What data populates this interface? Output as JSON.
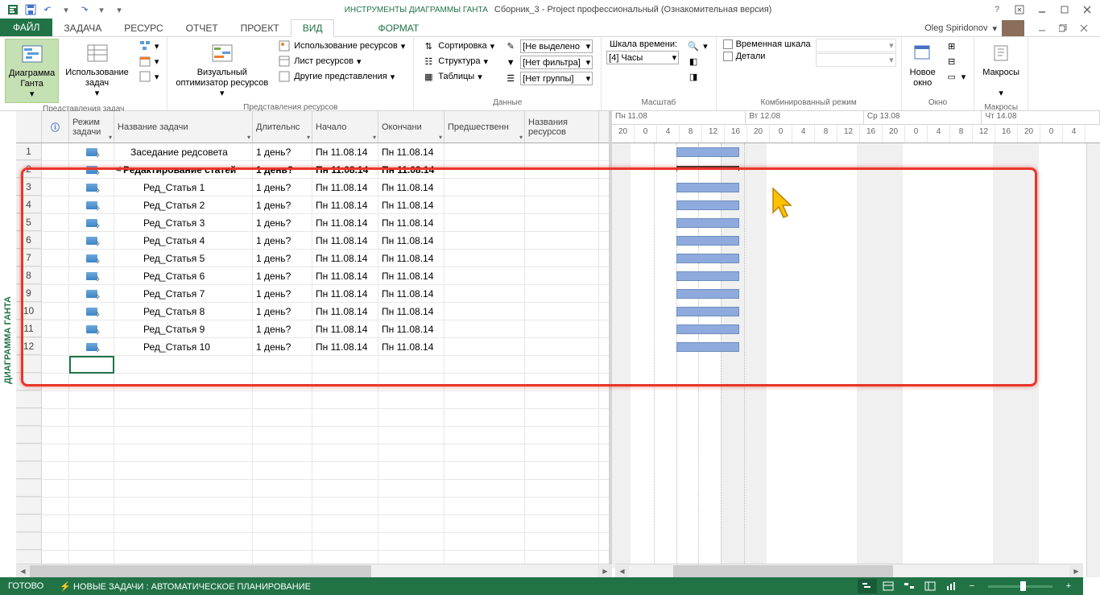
{
  "titlebar": {
    "tools_label": "ИНСТРУМЕНТЫ ДИАГРАММЫ ГАНТА",
    "window_title": "Сборник_3 - Project профессиональный (Ознакомительная версия)",
    "help": "?"
  },
  "tabs": {
    "file": "ФАЙЛ",
    "task": "ЗАДАЧА",
    "resource": "РЕСУРС",
    "report": "ОТЧЕТ",
    "project": "ПРОЕКТ",
    "view": "ВИД",
    "format": "ФОРМАТ"
  },
  "user": {
    "name": "Oleg Spiridonov"
  },
  "ribbon": {
    "group1": {
      "gantt": "Диаграмма\nГанта",
      "usage": "Использование\nзадач",
      "label": "Представления задач"
    },
    "group2": {
      "optimizer": "Визуальный\nоптимизатор ресурсов",
      "res_usage": "Использование ресурсов",
      "res_sheet": "Лист ресурсов",
      "other": "Другие представления",
      "label": "Представления ресурсов"
    },
    "group3": {
      "sort": "Сортировка",
      "structure": "Структура",
      "tables": "Таблицы",
      "highlight": "[Не выделено",
      "filter": "[Нет фильтра]",
      "group": "[Нет группы]",
      "label": "Данные"
    },
    "group4": {
      "timescale_label": "Шкала времени:",
      "timescale_value": "[4] Часы",
      "label": "Масштаб"
    },
    "group5": {
      "timeline": "Временная шкала",
      "details": "Детали",
      "label": "Комбинированный режим"
    },
    "group6": {
      "newwin": "Новое\nокно",
      "label": "Окно"
    },
    "group7": {
      "macros": "Макросы",
      "label": "Макросы"
    }
  },
  "side_label": "ДИАГРАММА ГАНТА",
  "columns": {
    "info": "",
    "mode": "Режим\nзадачи",
    "name": "Название задачи",
    "duration": "Длительнс",
    "start": "Начало",
    "finish": "Окончани",
    "pred": "Предшественн",
    "res": "Названия\nресурсов"
  },
  "timeline": {
    "days": [
      "Пн 11.08",
      "Вт 12.08",
      "Ср 13.08",
      "Чт 14.08"
    ],
    "hours": [
      "20",
      "0",
      "4",
      "8",
      "12",
      "16",
      "20",
      "0",
      "4",
      "8",
      "12",
      "16",
      "20",
      "0",
      "4",
      "8",
      "12",
      "16",
      "20",
      "0",
      "4"
    ]
  },
  "tasks": [
    {
      "num": "1",
      "name": "Заседание редсовета",
      "dur": "1 день?",
      "start": "Пн 11.08.14",
      "finish": "Пн 11.08.14",
      "bold": false,
      "indent": 1
    },
    {
      "num": "2",
      "name": "Редактирование статей",
      "dur": "1 день?",
      "start": "Пн 11.08.14",
      "finish": "Пн 11.08.14",
      "bold": true,
      "indent": 0,
      "summary": true
    },
    {
      "num": "3",
      "name": "Ред_Статья 1",
      "dur": "1 день?",
      "start": "Пн 11.08.14",
      "finish": "Пн 11.08.14",
      "bold": false,
      "indent": 2
    },
    {
      "num": "4",
      "name": "Ред_Статья 2",
      "dur": "1 день?",
      "start": "Пн 11.08.14",
      "finish": "Пн 11.08.14",
      "bold": false,
      "indent": 2
    },
    {
      "num": "5",
      "name": "Ред_Статья 3",
      "dur": "1 день?",
      "start": "Пн 11.08.14",
      "finish": "Пн 11.08.14",
      "bold": false,
      "indent": 2
    },
    {
      "num": "6",
      "name": "Ред_Статья 4",
      "dur": "1 день?",
      "start": "Пн 11.08.14",
      "finish": "Пн 11.08.14",
      "bold": false,
      "indent": 2
    },
    {
      "num": "7",
      "name": "Ред_Статья 5",
      "dur": "1 день?",
      "start": "Пн 11.08.14",
      "finish": "Пн 11.08.14",
      "bold": false,
      "indent": 2
    },
    {
      "num": "8",
      "name": "Ред_Статья 6",
      "dur": "1 день?",
      "start": "Пн 11.08.14",
      "finish": "Пн 11.08.14",
      "bold": false,
      "indent": 2
    },
    {
      "num": "9",
      "name": "Ред_Статья 7",
      "dur": "1 день?",
      "start": "Пн 11.08.14",
      "finish": "Пн 11.08.14",
      "bold": false,
      "indent": 2
    },
    {
      "num": "10",
      "name": "Ред_Статья 8",
      "dur": "1 день?",
      "start": "Пн 11.08.14",
      "finish": "Пн 11.08.14",
      "bold": false,
      "indent": 2
    },
    {
      "num": "11",
      "name": "Ред_Статья 9",
      "dur": "1 день?",
      "start": "Пн 11.08.14",
      "finish": "Пн 11.08.14",
      "bold": false,
      "indent": 2
    },
    {
      "num": "12",
      "name": "Ред_Статья 10",
      "dur": "1 день?",
      "start": "Пн 11.08.14",
      "finish": "Пн 11.08.14",
      "bold": false,
      "indent": 2
    }
  ],
  "status": {
    "ready": "ГОТОВО",
    "newtasks": "НОВЫЕ ЗАДАЧИ : АВТОМАТИЧЕСКОЕ ПЛАНИРОВАНИЕ"
  }
}
